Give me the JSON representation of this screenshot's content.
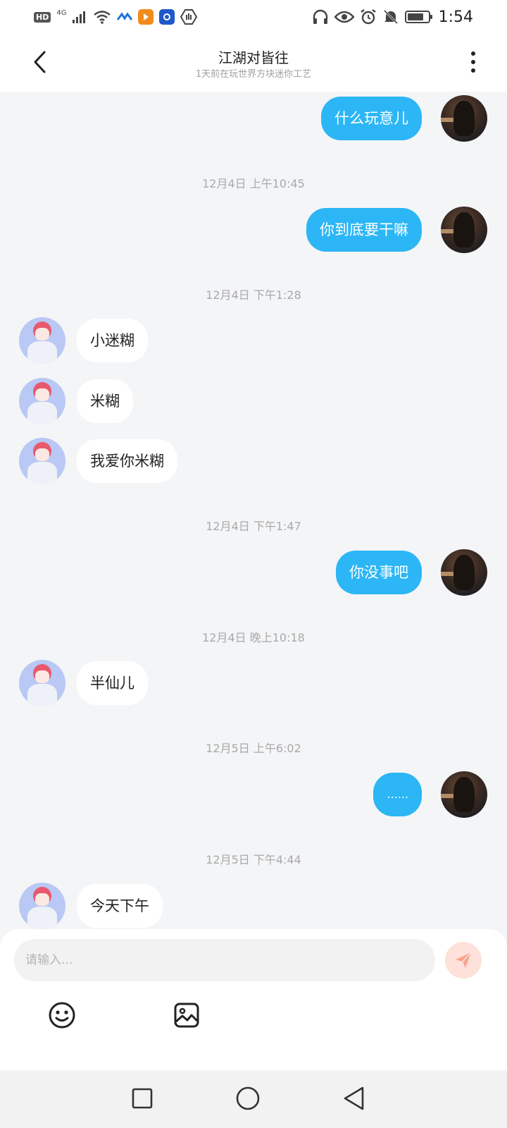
{
  "status_bar": {
    "hd_badge": "HD",
    "network": "4G",
    "time": "1:54",
    "icons": [
      "signal-icon",
      "wifi-icon",
      "app-icon-1",
      "app-icon-2",
      "app-icon-3",
      "app-icon-4",
      "headphones-icon",
      "eye-icon",
      "alarm-icon",
      "mute-icon",
      "battery-icon"
    ]
  },
  "header": {
    "title": "江湖对皆往",
    "subtitle": "1天前在玩世界方块迷你工艺"
  },
  "messages": [
    {
      "type": "message",
      "sender": "me",
      "text": "什么玩意儿"
    },
    {
      "type": "timestamp",
      "text": "12月4日 上午10:45"
    },
    {
      "type": "message",
      "sender": "me",
      "text": "你到底要干嘛"
    },
    {
      "type": "timestamp",
      "text": "12月4日 下午1:28"
    },
    {
      "type": "message",
      "sender": "other",
      "text": "小迷糊"
    },
    {
      "type": "message",
      "sender": "other",
      "text": "米糊"
    },
    {
      "type": "message",
      "sender": "other",
      "text": "我爱你米糊"
    },
    {
      "type": "timestamp",
      "text": "12月4日 下午1:47"
    },
    {
      "type": "message",
      "sender": "me",
      "text": "你没事吧"
    },
    {
      "type": "timestamp",
      "text": "12月4日 晚上10:18"
    },
    {
      "type": "message",
      "sender": "other",
      "text": "半仙儿"
    },
    {
      "type": "timestamp",
      "text": "12月5日 上午6:02"
    },
    {
      "type": "message",
      "sender": "me",
      "text": "......"
    },
    {
      "type": "timestamp",
      "text": "12月5日 下午4:44"
    },
    {
      "type": "message",
      "sender": "other",
      "text": "今天下午"
    }
  ],
  "composer": {
    "placeholder": "请输入...",
    "value": ""
  },
  "colors": {
    "my_bubble": "#2cb6f5",
    "other_bubble": "#ffffff",
    "background": "#f4f5f7",
    "send_button": "#fde1da",
    "send_icon": "#f7a58f"
  }
}
